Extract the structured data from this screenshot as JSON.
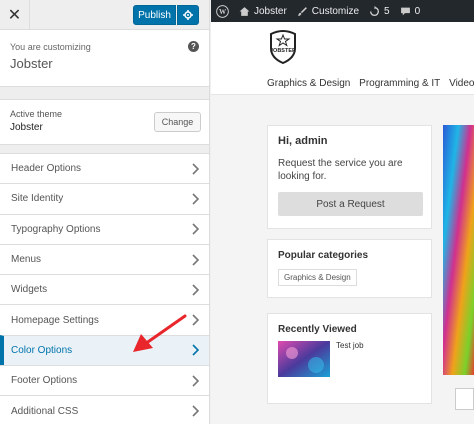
{
  "customizer": {
    "publish_label": "Publish",
    "customizing_label": "You are customizing",
    "site_name": "Jobster",
    "active_theme_label": "Active theme",
    "theme_name": "Jobster",
    "change_label": "Change",
    "menu": [
      {
        "label": "Header Options"
      },
      {
        "label": "Site Identity"
      },
      {
        "label": "Typography Options"
      },
      {
        "label": "Menus"
      },
      {
        "label": "Widgets"
      },
      {
        "label": "Homepage Settings"
      },
      {
        "label": "Color Options"
      },
      {
        "label": "Footer Options"
      },
      {
        "label": "Additional CSS"
      }
    ],
    "accent": "#0073aa"
  },
  "adminbar": {
    "site_name": "Jobster",
    "customize_label": "Customize",
    "updates_count": "5",
    "comments_count": "0"
  },
  "preview": {
    "logo_text": "JOBSTER",
    "nav": [
      "Graphics & Design",
      "Programming & IT",
      "Video &"
    ],
    "greeting": "Hi, admin",
    "request_text": "Request the service you are looking for.",
    "post_request_label": "Post a Request",
    "popular_title": "Popular categories",
    "category_tag": "Graphics & Design",
    "recent_title": "Recently Viewed",
    "recent_item": "Test job"
  }
}
